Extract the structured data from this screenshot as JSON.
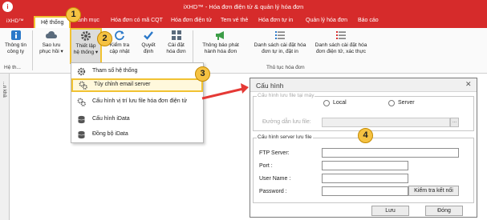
{
  "app": {
    "logo_text": "i",
    "title": "iXHD™ - Hóa đơn điện tử & quản lý hóa đơn"
  },
  "menu": {
    "prefix": "iXHD™",
    "tabs": [
      "Hệ thống",
      "Danh mục",
      "Hóa đơn có mã CQT",
      "Hóa đơn điện tử",
      "Tem vé thẻ",
      "Hóa đơn tự in",
      "Quản lý hóa đơn",
      "Báo cáo"
    ]
  },
  "ribbon": {
    "buttons": [
      {
        "label": "Thông tin\ncông ty",
        "icon": "info-icon"
      },
      {
        "label": "Sao lưu\nphục hồi ▾",
        "icon": "cloud-icon"
      },
      {
        "label": "Thiết lập\nhệ thống ▾",
        "icon": "gear-icon"
      },
      {
        "label": "Kiểm tra\ncập nhật",
        "icon": "refresh-icon"
      },
      {
        "label": "Quyết\nđịnh",
        "icon": "check-icon"
      },
      {
        "label": "Cài đặt\nhóa đơn",
        "icon": "grid-icon"
      },
      {
        "label": "Thông báo phát\nhành hóa đơn",
        "icon": "megaphone-icon"
      },
      {
        "label": "Danh sách cài đặt hóa\nđơn tự in, đặt in",
        "icon": "list-icon"
      },
      {
        "label": "Danh sách cài đặt hóa\nđơn điện tử, xác thực",
        "icon": "list-check-icon"
      }
    ],
    "groups": [
      "Hệ th...",
      "Thủ tục hóa đơn"
    ]
  },
  "side_strip": {
    "label": "...n khả"
  },
  "dropdown": {
    "items": [
      {
        "label": "Tham số hệ thống",
        "icon": "settings-icon"
      },
      {
        "label": "Tùy chỉnh email server",
        "icon": "gears-icon"
      },
      {
        "label": "Cấu hình vị trí lưu file hóa đơn điện tử",
        "icon": "gears-icon"
      },
      {
        "label": "Cấu hình iData",
        "icon": "database-icon"
      },
      {
        "label": "Đồng bộ iData",
        "icon": "database-icon"
      }
    ]
  },
  "steps": [
    "1",
    "2",
    "3",
    "4"
  ],
  "dialog": {
    "title": "Cấu hình",
    "close": "✕",
    "storage_section": "Cấu hình lưu file tại máy",
    "radio_local": "Local",
    "radio_server": "Server",
    "path_label": "Đường dẫn lưu file:",
    "path_value": "",
    "browse": "...",
    "server_section": "Cấu hình server lưu file",
    "ftp_label": "FTP Server:",
    "port_label": "Port :",
    "user_label": "User Name :",
    "password_label": "Password :",
    "ftp_value": "",
    "port_value": "",
    "user_value": "",
    "password_value": "",
    "test_button": "Kiểm tra kết nối",
    "save_button": "Lưu",
    "close_button": "Đóng"
  },
  "colors": {
    "brand": "#d62b2b",
    "highlight": "#f1c232",
    "step_badge": "#f5c242",
    "arrow": "#e53935"
  }
}
